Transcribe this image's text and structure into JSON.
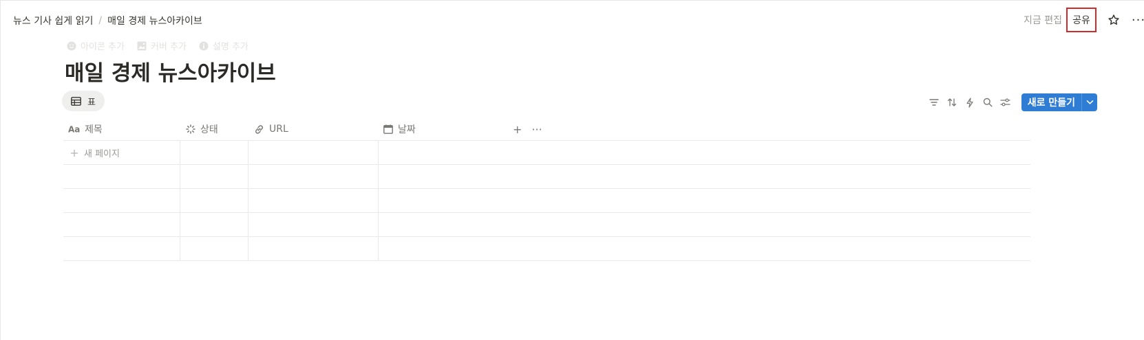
{
  "breadcrumb": {
    "parent": "뉴스 기사 쉽게 읽기",
    "separator": "/",
    "current": "매일 경제 뉴스아카이브"
  },
  "topbar": {
    "edited_label": "지금 편집",
    "share_label": "공유",
    "more_label": "···"
  },
  "page_controls": {
    "add_icon": "아이콘 추가",
    "add_cover": "커버 추가",
    "add_description": "설명 추가"
  },
  "page": {
    "title": "매일 경제 뉴스아카이브"
  },
  "view": {
    "tab_label": "표"
  },
  "toolbar": {
    "new_label": "새로 만들기",
    "accent": "#2e7cd3"
  },
  "table": {
    "columns": [
      {
        "label": "제목",
        "icon": "text-type-icon"
      },
      {
        "label": "상태",
        "icon": "status-loader-icon"
      },
      {
        "label": "URL",
        "icon": "link-icon"
      },
      {
        "label": "날짜",
        "icon": "calendar-icon"
      }
    ],
    "add_column_label": "+",
    "column_more_label": "···",
    "new_page_label": "새 페이지"
  }
}
